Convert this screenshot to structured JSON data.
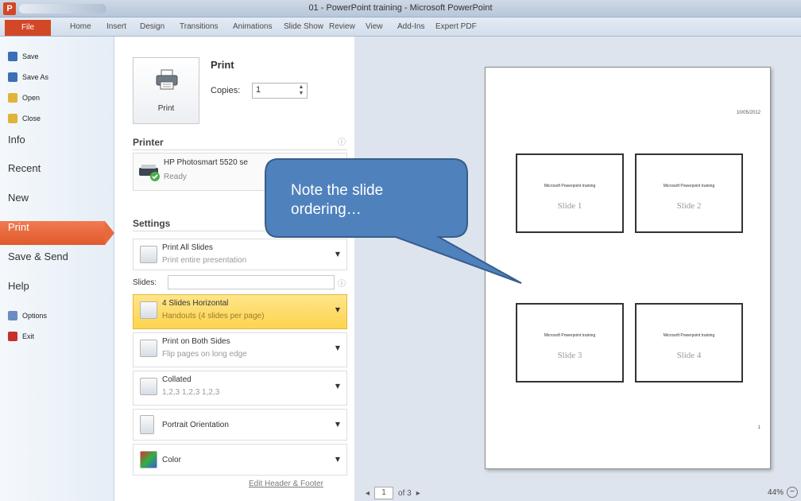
{
  "window": {
    "title": "01 - PowerPoint training - Microsoft PowerPoint",
    "app_letter": "P"
  },
  "ribbon_tabs": [
    "File",
    "Home",
    "Insert",
    "Design",
    "Transitions",
    "Animations",
    "Slide Show",
    "Review",
    "View",
    "Add-Ins",
    "Expert PDF"
  ],
  "nav": {
    "commands": [
      {
        "label": "Save",
        "icon": "save-icon",
        "color": "#3b6fb6"
      },
      {
        "label": "Save As",
        "icon": "save-as-icon",
        "color": "#3b6fb6"
      },
      {
        "label": "Open",
        "icon": "open-folder-icon",
        "color": "#e0b43a"
      },
      {
        "label": "Close",
        "icon": "close-folder-icon",
        "color": "#e0b43a"
      }
    ],
    "items": [
      "Info",
      "Recent",
      "New",
      "Print",
      "Save & Send",
      "Help"
    ],
    "active": "Print",
    "bottom_commands": [
      {
        "label": "Options",
        "icon": "options-icon",
        "color": "#6a8cc0"
      },
      {
        "label": "Exit",
        "icon": "exit-icon",
        "color": "#c8302a"
      }
    ]
  },
  "print": {
    "heading": "Print",
    "button_label": "Print",
    "copies_label": "Copies:",
    "copies_value": "1",
    "printer_heading": "Printer",
    "printer_name": "HP Photosmart 5520 se",
    "printer_status": "Ready",
    "settings_heading": "Settings",
    "slides_label": "Slides:",
    "settings": [
      {
        "title": "Print All Slides",
        "sub": "Print entire presentation",
        "icon": "print-all-slides-icon"
      },
      {
        "title": "4 Slides Horizontal",
        "sub": "Handouts (4 slides per page)",
        "icon": "handout-layout-icon",
        "highlight": true
      },
      {
        "title": "Print on Both Sides",
        "sub": "Flip pages on long edge",
        "icon": "duplex-icon"
      },
      {
        "title": "Collated",
        "sub": "1,2,3   1,2,3   1,2,3",
        "icon": "collated-icon"
      },
      {
        "title": "Portrait Orientation",
        "sub": "",
        "icon": "portrait-icon"
      },
      {
        "title": "Color",
        "sub": "",
        "icon": "color-icon"
      }
    ],
    "edit_link": "Edit Header & Footer"
  },
  "preview": {
    "date": "10/05/2012",
    "page_number": "1",
    "thumbs": [
      {
        "title": "Microsoft Powerpoint training",
        "slide": "Slide 1"
      },
      {
        "title": "Microsoft Powerpoint training",
        "slide": "Slide 2"
      },
      {
        "title": "Microsoft Powerpoint training",
        "slide": "Slide 3"
      },
      {
        "title": "Microsoft Powerpoint training",
        "slide": "Slide 4"
      }
    ],
    "pager_current": "1",
    "pager_total": "of 3",
    "zoom": "44%"
  },
  "callout": {
    "text_line1": "Note the slide",
    "text_line2": "ordering…",
    "fill": "#4f81bd",
    "stroke": "#385d8a"
  }
}
